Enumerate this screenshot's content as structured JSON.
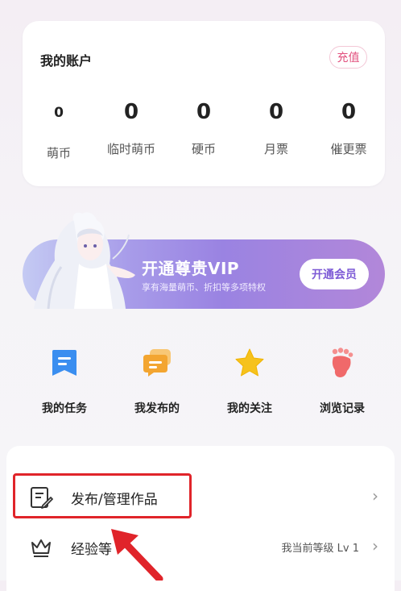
{
  "account": {
    "title": "我的账户",
    "recharge_label": "充值",
    "stats": [
      {
        "value": "0",
        "label": "萌币"
      },
      {
        "value": "0",
        "label": "临时萌币"
      },
      {
        "value": "0",
        "label": "硬币"
      },
      {
        "value": "0",
        "label": "月票"
      },
      {
        "value": "0",
        "label": "催更票"
      }
    ]
  },
  "vip": {
    "title": "开通尊贵VIP",
    "subtitle": "享有海量萌币、折扣等多项特权",
    "button_label": "开通会员"
  },
  "quick_actions": [
    {
      "label": "我的任务",
      "icon": "bookmark-icon",
      "color": "#3a8ef0"
    },
    {
      "label": "我发布的",
      "icon": "chat-bubble-icon",
      "color": "#f3a530"
    },
    {
      "label": "我的关注",
      "icon": "star-icon",
      "color": "#f6c21c"
    },
    {
      "label": "浏览记录",
      "icon": "footprint-icon",
      "color": "#f0696a"
    }
  ],
  "menu": {
    "publish_label": "发布/管理作品",
    "level_label": "经验等",
    "level_status": "我当前等级 Lv 1"
  },
  "colors": {
    "accent_pink": "#e2507e",
    "vip_purple": "#9a83e2",
    "highlight_red": "#e0242a"
  }
}
